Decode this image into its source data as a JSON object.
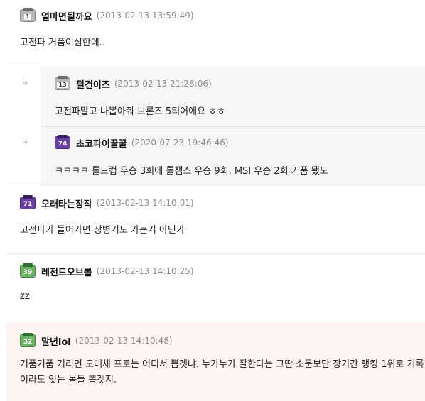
{
  "comments": [
    {
      "nick": "얼마면될까요",
      "date": "(2013-02-13 13:59:49)",
      "level": "1",
      "body": "고전파 거품이심한데.."
    },
    {
      "nick": "오래타는장작",
      "date": "(2013-02-13 14:10:01)",
      "level": "71",
      "body": "고전파가 들어가면 장병기도 가는거 아닌가"
    },
    {
      "nick": "레전드오브롤",
      "date": "(2013-02-13 14:10:25)",
      "level": "39",
      "body": "zz"
    },
    {
      "nick": "말년lol",
      "date": "(2013-02-13 14:10:48)",
      "level": "32",
      "body": "거품거품 거리면 도대체 프로는 어디서 뽑겟냐. 누가누가 잘한다는 그딴 소문보단 장기간 랭킹 1위로 기록이라도 잇는 놈들 뽑겟지."
    }
  ],
  "replies": [
    {
      "arrow": "↳",
      "nick": "펄건이즈",
      "date": "(2013-02-13 21:28:06)",
      "level": "13",
      "body": "고전파말고 나뽑아줘 브론즈 5티어에요 ㅎㅎ"
    },
    {
      "arrow": "↳",
      "nick": "초코파이꿀꿀",
      "date": "(2020-07-23 19:46:46)",
      "level": "74",
      "body": "ㅋㅋㅋㅋ 롤드컵 우승 3회에 롤챔스 우승 9회, MSI 우승 2회 거품 됐노"
    }
  ]
}
